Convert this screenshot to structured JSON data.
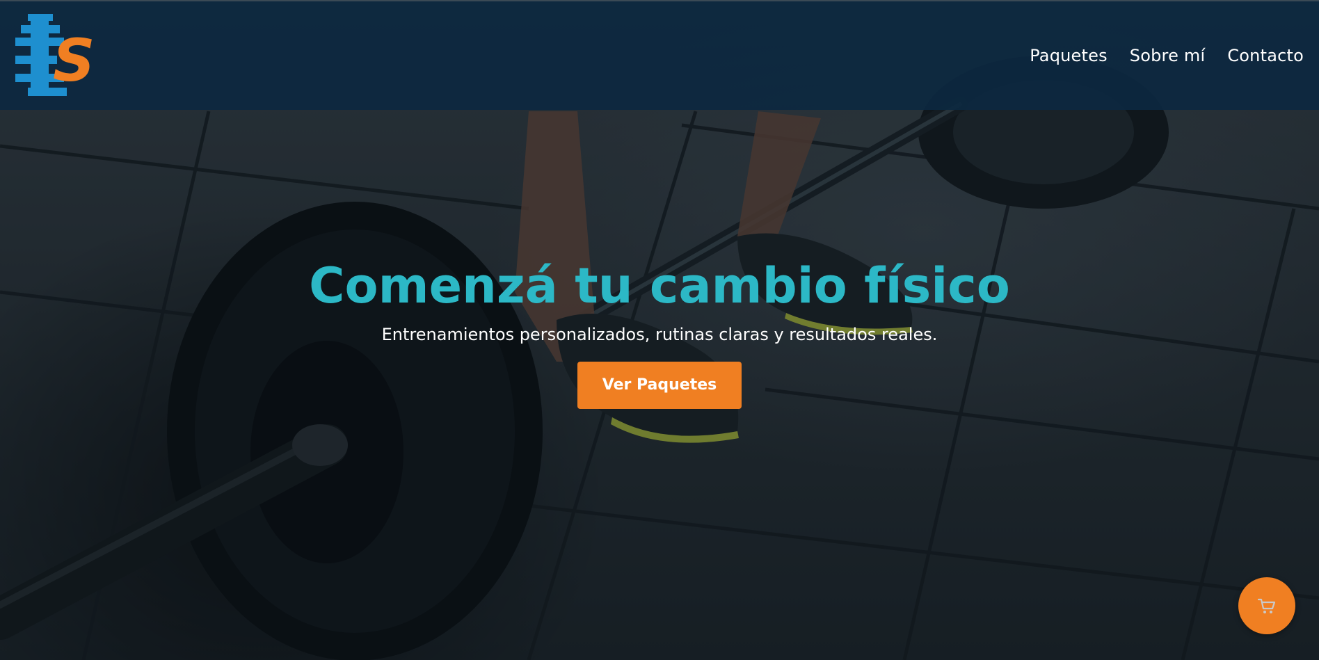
{
  "brand": {
    "logo_icon": "dumbbell-fs-logo-icon",
    "logo_letter": "S"
  },
  "nav": {
    "items": [
      {
        "label": "Paquetes"
      },
      {
        "label": "Sobre mí"
      },
      {
        "label": "Contacto"
      }
    ]
  },
  "hero": {
    "title": "Comenzá tu cambio físico",
    "subtitle": "Entrenamientos personalizados, rutinas claras y resultados reales.",
    "cta_label": "Ver Paquetes",
    "background": "gym-floor-barbell-photo"
  },
  "cart": {
    "icon": "shopping-cart-icon"
  },
  "colors": {
    "header_bg": "#0c2840",
    "accent_teal": "#2cb8c6",
    "accent_orange": "#f07f22",
    "logo_blue": "#1e8fcf",
    "text_white": "#ffffff"
  }
}
